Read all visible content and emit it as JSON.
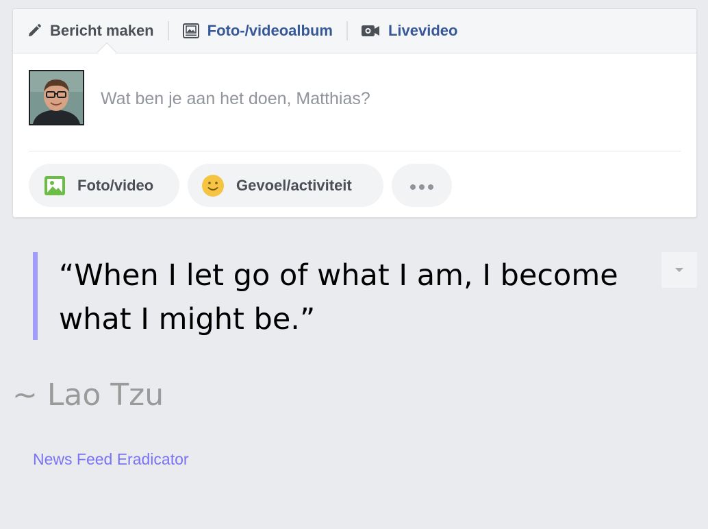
{
  "composer": {
    "tabs": [
      {
        "label": "Bericht maken",
        "icon": "pencil-icon"
      },
      {
        "label": "Foto-/videoalbum",
        "icon": "photo-album-icon"
      },
      {
        "label": "Livevideo",
        "icon": "video-camera-icon"
      }
    ],
    "status_placeholder": "Wat ben je aan het doen, Matthias?",
    "actions": [
      {
        "label": "Foto/video",
        "icon": "photo-icon"
      },
      {
        "label": "Gevoel/activiteit",
        "icon": "smiley-icon"
      },
      {
        "label": "",
        "icon": "more-dots-icon"
      }
    ]
  },
  "quote": {
    "text": "“When I let go of what I am, I become what I might be.”",
    "author": "~ Lao Tzu"
  },
  "footer": {
    "link_label": "News Feed Eradicator"
  },
  "colors": {
    "background": "#e9ebee",
    "link_blue": "#365899",
    "quote_accent": "#a29df8",
    "eradicator_link": "#7a73f5",
    "photo_icon_green": "#6bbd45",
    "smiley_yellow": "#f6c443"
  }
}
